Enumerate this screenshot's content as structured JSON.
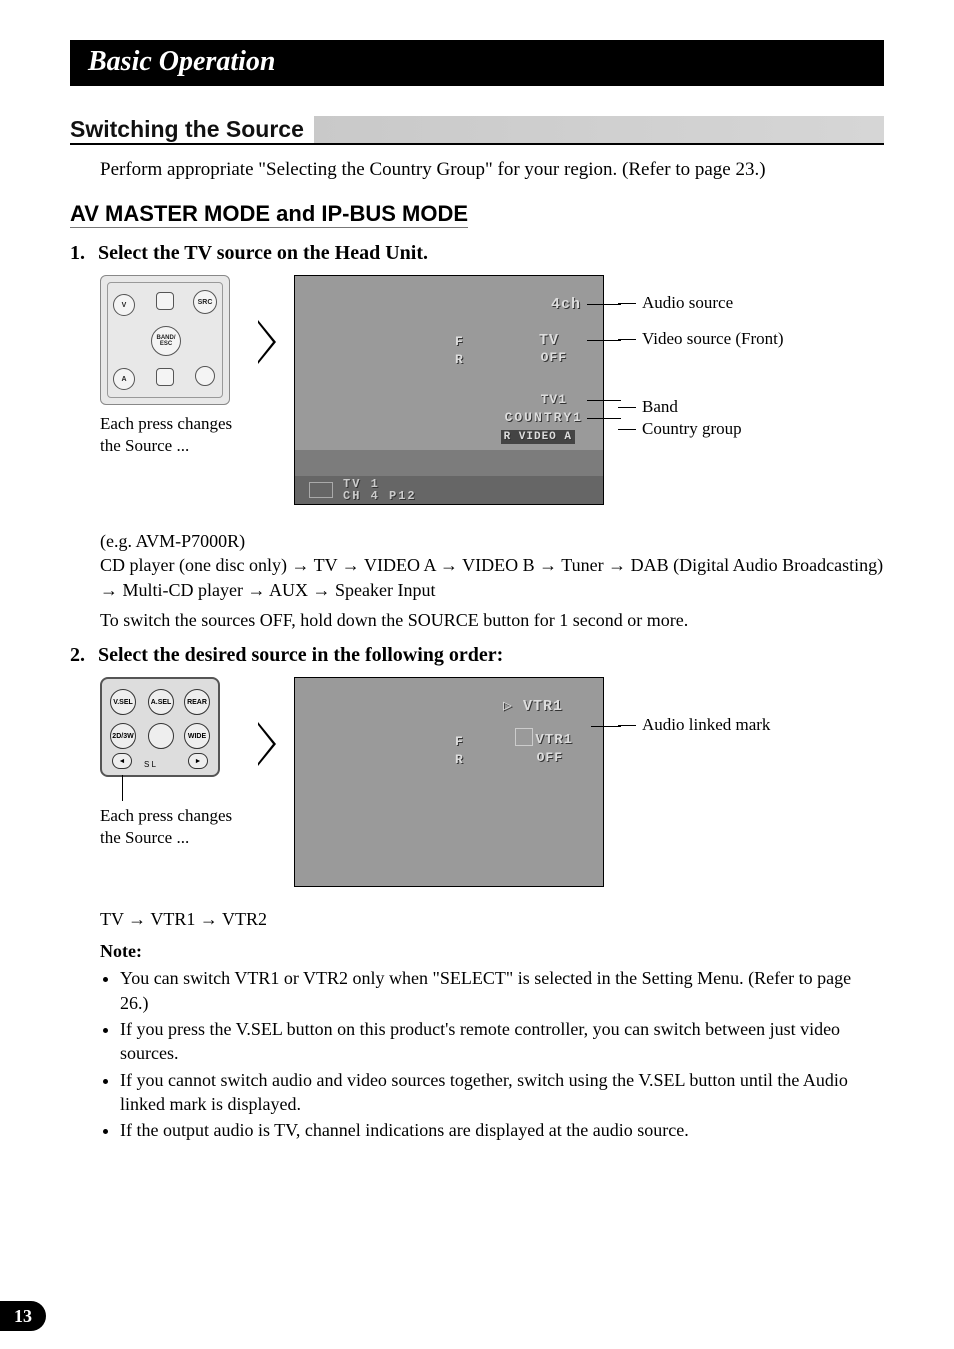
{
  "title": "Basic Operation",
  "section1_heading": "Switching the Source",
  "intro": "Perform appropriate \"Selecting the Country Group\" for your region. (Refer to page 23.)",
  "section2_heading": "AV MASTER MODE and IP-BUS MODE",
  "step1": {
    "num": "1.",
    "title": "Select the TV source on the Head Unit.",
    "caption": "Each press changes the Source ...",
    "example_line": "(e.g. AVM-P7000R)",
    "chain": "CD player (one disc only) → TV → VIDEO A → VIDEO B → Tuner → DAB (Digital Audio Broadcasting) → Multi-CD player → AUX → Speaker Input",
    "off_note": "To switch the sources OFF, hold down the SOURCE button for 1 second or more."
  },
  "screen1": {
    "audio_source": "4ch",
    "video_source": "TV",
    "video_off": "OFF",
    "f_label": "F",
    "r_label": "R",
    "band": "TV1",
    "country": "COUNTRY1",
    "video_badge": "R VIDEO A",
    "foot_top": "TV   1",
    "foot_bot": "CH   4    P12"
  },
  "callouts1": {
    "a": "Audio source",
    "b": "Video source (Front)",
    "c": "Band",
    "d": "Country group"
  },
  "step2": {
    "num": "2.",
    "title": "Select the desired source in the following order:",
    "caption": "Each press changes the Source ...",
    "chain": "TV → VTR1 → VTR2"
  },
  "screen2": {
    "top": "VTR1",
    "mid": "VTR1",
    "off": "OFF",
    "f_label": "F",
    "r_label": "R"
  },
  "callouts2": {
    "a": "Audio linked mark"
  },
  "remote1": {
    "b_v": "V",
    "b_src": "SRC",
    "b_band": "BAND/\nESC",
    "b_a": "A"
  },
  "remote2": {
    "b_vsel": "V.SEL",
    "b_asel": "A.SEL",
    "b_rear": "REAR",
    "b_30sw": "2D/3W",
    "b_wide": "WIDE",
    "sl_label": "S L"
  },
  "note_heading": "Note:",
  "notes": [
    "You can switch VTR1 or VTR2 only when \"SELECT\" is selected in the Setting Menu. (Refer to page 26.)",
    "If you press the V.SEL button on this product's remote controller, you can switch between just video sources.",
    "If you cannot switch audio and video sources together, switch using the V.SEL button until the Audio linked mark is displayed.",
    "If the output audio is TV, channel indications are displayed at the audio source."
  ],
  "page_number": "13"
}
